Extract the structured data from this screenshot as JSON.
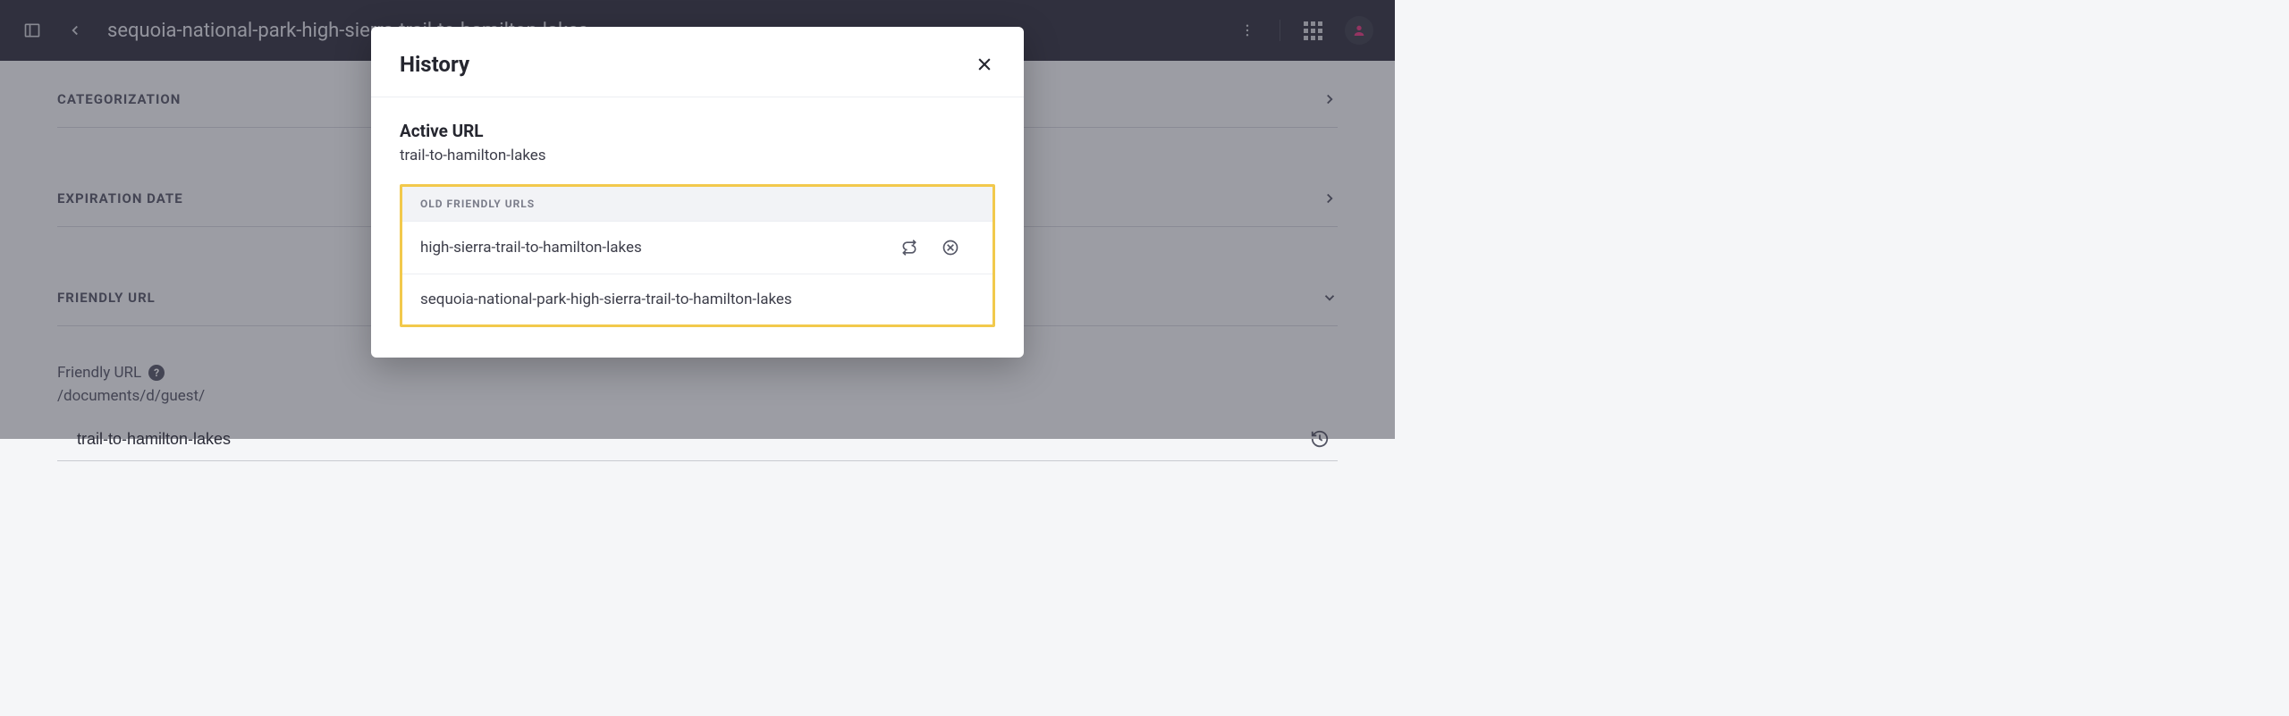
{
  "header": {
    "page_title": "sequoia-national-park-high-sierra-trail-to-hamilton-lakes"
  },
  "sections": {
    "categorization": "CATEGORIZATION",
    "expiration": "EXPIRATION DATE",
    "friendly_url": "FRIENDLY URL"
  },
  "friendly_url_field": {
    "label": "Friendly URL",
    "prefix": "/documents/d/guest/",
    "value": "trail-to-hamilton-lakes"
  },
  "modal": {
    "title": "History",
    "active_label": "Active URL",
    "active_value": "trail-to-hamilton-lakes",
    "old_header": "OLD FRIENDLY URLS",
    "old": [
      "high-sierra-trail-to-hamilton-lakes",
      "sequoia-national-park-high-sierra-trail-to-hamilton-lakes"
    ]
  }
}
